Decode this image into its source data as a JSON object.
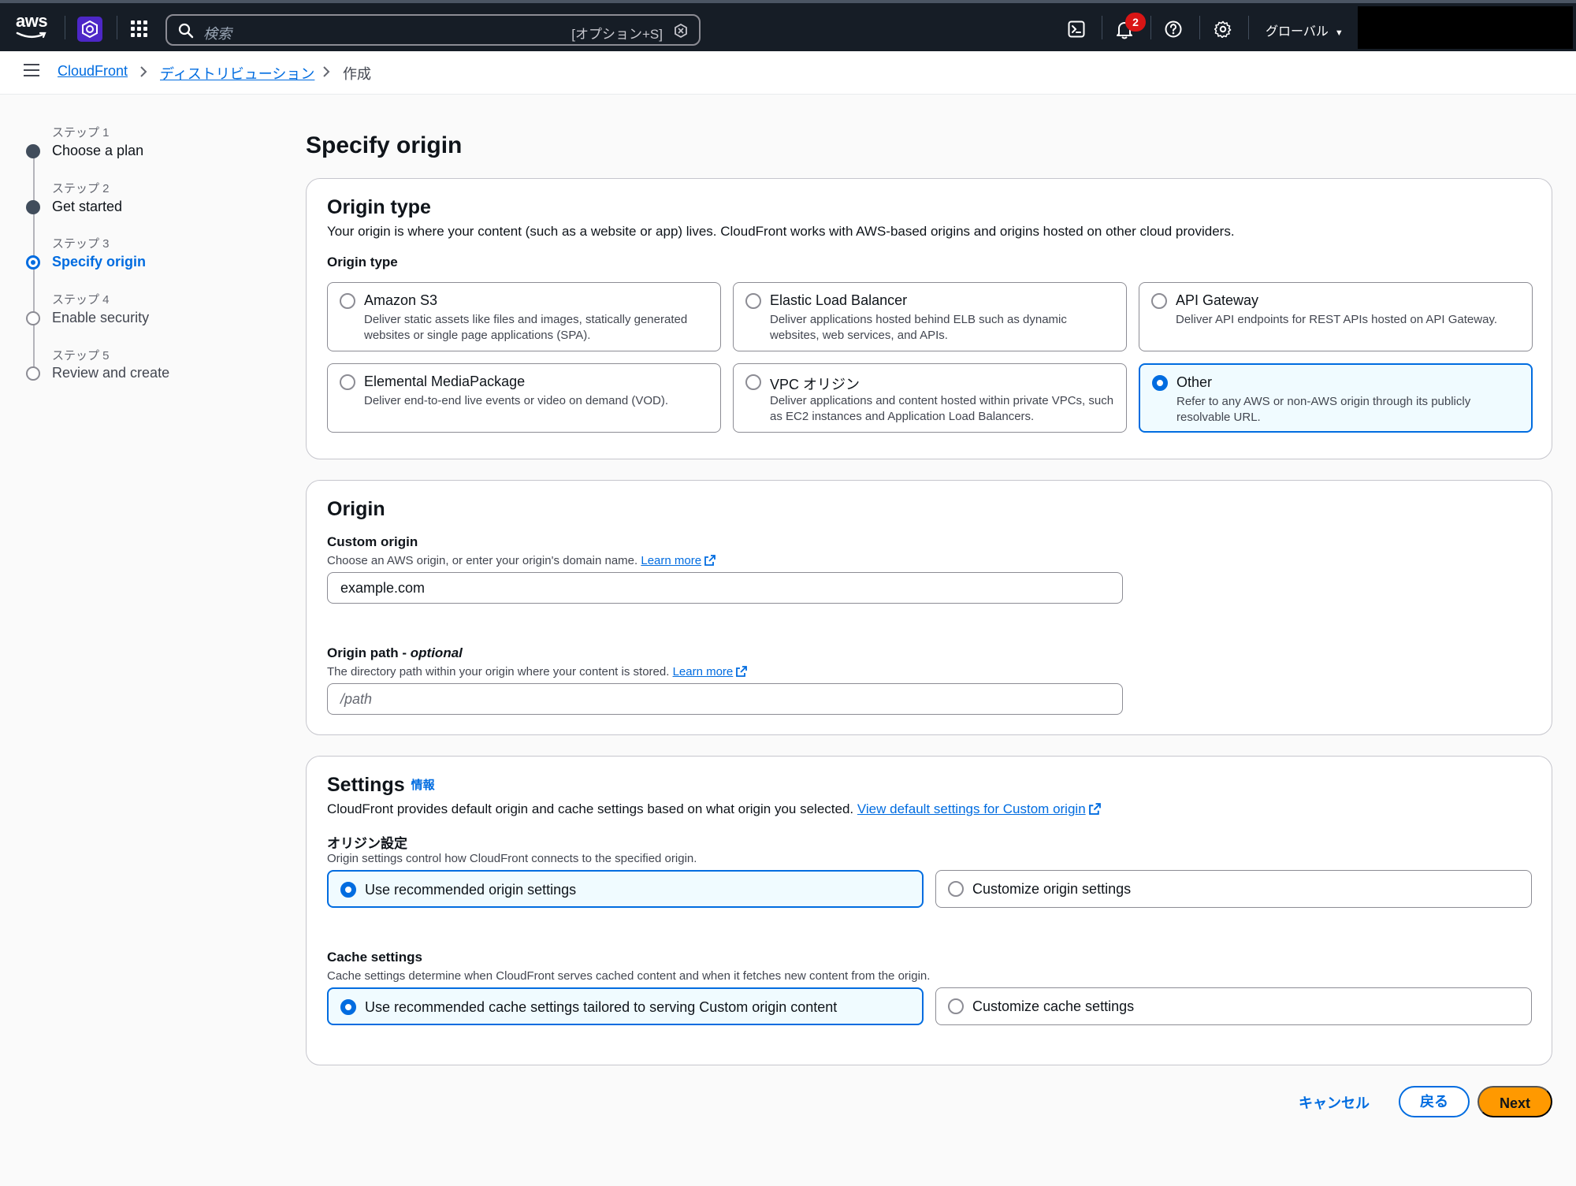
{
  "topnav": {
    "logo": "aws",
    "search_placeholder": "検索",
    "search_shortcut": "[オプション+S]",
    "notification_count": "2",
    "region": "グローバル"
  },
  "breadcrumb": {
    "items": [
      "CloudFront",
      "ディストリビューション",
      "作成"
    ]
  },
  "steps": [
    {
      "num": "ステップ 1",
      "label": "Choose a plan",
      "state": "done"
    },
    {
      "num": "ステップ 2",
      "label": "Get started",
      "state": "done"
    },
    {
      "num": "ステップ 3",
      "label": "Specify origin",
      "state": "current"
    },
    {
      "num": "ステップ 4",
      "label": "Enable security",
      "state": "todo"
    },
    {
      "num": "ステップ 5",
      "label": "Review and create",
      "state": "todo"
    }
  ],
  "page_title": "Specify origin",
  "origin_type": {
    "heading": "Origin type",
    "description": "Your origin is where your content (such as a website or app) lives. CloudFront works with AWS-based origins and origins hosted on other cloud providers.",
    "label": "Origin type",
    "options": [
      {
        "title": "Amazon S3",
        "desc": "Deliver static assets like files and images, statically generated websites or single page applications (SPA).",
        "selected": false
      },
      {
        "title": "Elastic Load Balancer",
        "desc": "Deliver applications hosted behind ELB such as dynamic websites, web services, and APIs.",
        "selected": false
      },
      {
        "title": "API Gateway",
        "desc": "Deliver API endpoints for REST APIs hosted on API Gateway.",
        "selected": false
      },
      {
        "title": "Elemental MediaPackage",
        "desc": "Deliver end-to-end live events or video on demand (VOD).",
        "selected": false
      },
      {
        "title": "VPC オリジン",
        "desc": "Deliver applications and content hosted within private VPCs, such as EC2 instances and Application Load Balancers.",
        "selected": false
      },
      {
        "title": "Other",
        "desc": "Refer to any AWS or non-AWS origin through its publicly resolvable URL.",
        "selected": true
      }
    ]
  },
  "origin": {
    "heading": "Origin",
    "custom_label": "Custom origin",
    "custom_desc": "Choose an AWS origin, or enter your origin's domain name.",
    "learn_more": "Learn more",
    "custom_value": "example.com",
    "path_label": "Origin path - ",
    "path_optional": "optional",
    "path_desc": "The directory path within your origin where your content is stored.",
    "path_placeholder": "/path"
  },
  "settings": {
    "heading": "Settings",
    "info": "情報",
    "description": "CloudFront provides default origin and cache settings based on what origin you selected.",
    "view_defaults": "View default settings for Custom origin",
    "origin_label": "オリジン設定",
    "origin_desc": "Origin settings control how CloudFront connects to the specified origin.",
    "origin_options": [
      {
        "label": "Use recommended origin settings",
        "selected": true
      },
      {
        "label": "Customize origin settings",
        "selected": false
      }
    ],
    "cache_label": "Cache settings",
    "cache_desc": "Cache settings determine when CloudFront serves cached content and when it fetches new content from the origin.",
    "cache_options": [
      {
        "label": "Use recommended cache settings tailored to serving Custom origin content",
        "selected": true
      },
      {
        "label": "Customize cache settings",
        "selected": false
      }
    ]
  },
  "actions": {
    "cancel": "キャンセル",
    "back": "戻る",
    "next": "Next"
  }
}
